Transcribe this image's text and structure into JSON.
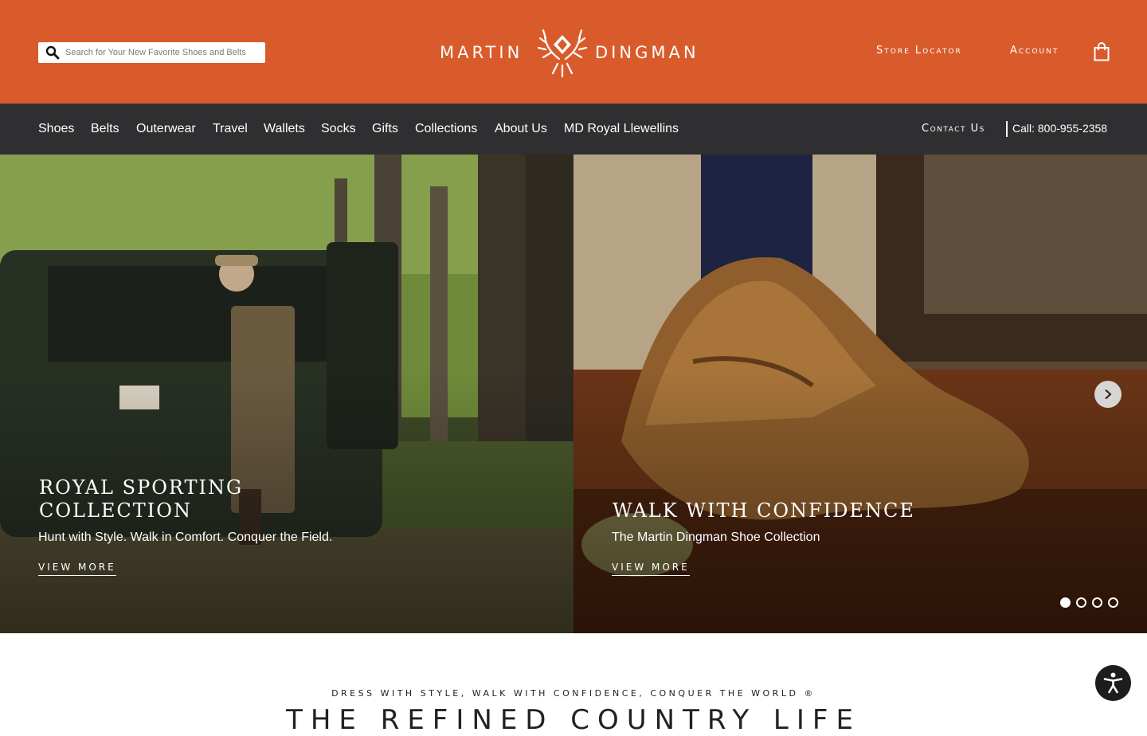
{
  "header": {
    "search_placeholder": "Search for Your New Favorite Shoes and Belts",
    "logo_left": "MARTIN",
    "logo_right": "DINGMAN",
    "store_locator": "Store Locator",
    "account": "Account",
    "background": "#d95b2b"
  },
  "categories": [
    "Shoes",
    "Belts",
    "Outerwear",
    "Travel",
    "Wallets",
    "Socks",
    "Gifts",
    "Collections",
    "About Us",
    "MD Royal Llewellins"
  ],
  "contact": {
    "label": "Contact Us",
    "phone": "Call: 800-955-2358"
  },
  "slides": [
    {
      "title": "ROYAL SPORTING\nCOLLECTION",
      "subtitle": "Hunt with Style. Walk in Comfort. Conquer the Field.",
      "link": "VIEW MORE"
    },
    {
      "title": "WALK WITH CONFIDENCE",
      "subtitle": "The Martin Dingman Shoe Collection",
      "link": "VIEW MORE"
    }
  ],
  "carousel": {
    "active_dot": 1,
    "dot_count": 4
  },
  "section": {
    "tagline": "DRESS WITH STYLE, WALK WITH CONFIDENCE, CONQUER THE WORLD ®",
    "heading": "THE REFINED COUNTRY LIFE"
  },
  "icons": {
    "search": "search-icon",
    "bag": "shopping-bag-icon",
    "next": "chevron-right-icon",
    "accessibility": "accessibility-icon"
  }
}
